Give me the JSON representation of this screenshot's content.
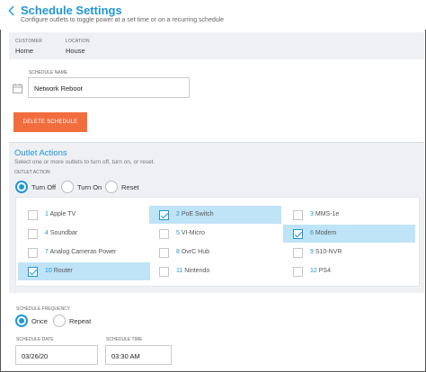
{
  "header": {
    "title": "Schedule Settings",
    "subtitle": "Configure outlets to toggle power at a set time or on a recurring schedule"
  },
  "customer": {
    "customer_label": "CUSTOMER",
    "customer_value": "Home",
    "location_label": "LOCATION",
    "location_value": "House"
  },
  "schedule_name": {
    "label": "SCHEDULE NAME",
    "value": "Network Reboot"
  },
  "delete_button": "DELETE SCHEDULE",
  "outlet_actions": {
    "title": "Outlet Actions",
    "subtitle": "Select one or more outlets to turn off, turn on, or reset.",
    "action_label": "OUTLET ACTION",
    "actions": [
      "Turn Off",
      "Turn On",
      "Reset"
    ],
    "selected_action": "Turn Off",
    "outlets": [
      {
        "num": "1",
        "name": "Apple TV",
        "checked": false
      },
      {
        "num": "2",
        "name": "PoE Switch",
        "checked": true
      },
      {
        "num": "3",
        "name": "MMS-1e",
        "checked": false
      },
      {
        "num": "4",
        "name": "Soundbar",
        "checked": false
      },
      {
        "num": "5",
        "name": "VI-Micro",
        "checked": false
      },
      {
        "num": "6",
        "name": "Modem",
        "checked": true
      },
      {
        "num": "7",
        "name": "Analog Cameras Power",
        "checked": false
      },
      {
        "num": "8",
        "name": "OvrC Hub",
        "checked": false
      },
      {
        "num": "9",
        "name": "S10-NVR",
        "checked": false
      },
      {
        "num": "10",
        "name": "Router",
        "checked": true
      },
      {
        "num": "11",
        "name": "Nintendo",
        "checked": false
      },
      {
        "num": "12",
        "name": "PS4",
        "checked": false
      }
    ]
  },
  "frequency": {
    "label": "SCHEDULE FREQUENCY",
    "options": [
      "Once",
      "Repeat"
    ],
    "selected": "Once"
  },
  "date": {
    "label": "SCHEDULE DATE",
    "value": "03/26/20"
  },
  "time": {
    "label": "SCHEDULE TIME",
    "value": "03:30 AM"
  },
  "colors": {
    "accent": "#2196d6",
    "danger": "#f26d3d",
    "selected_bg": "#bfe3f7"
  }
}
